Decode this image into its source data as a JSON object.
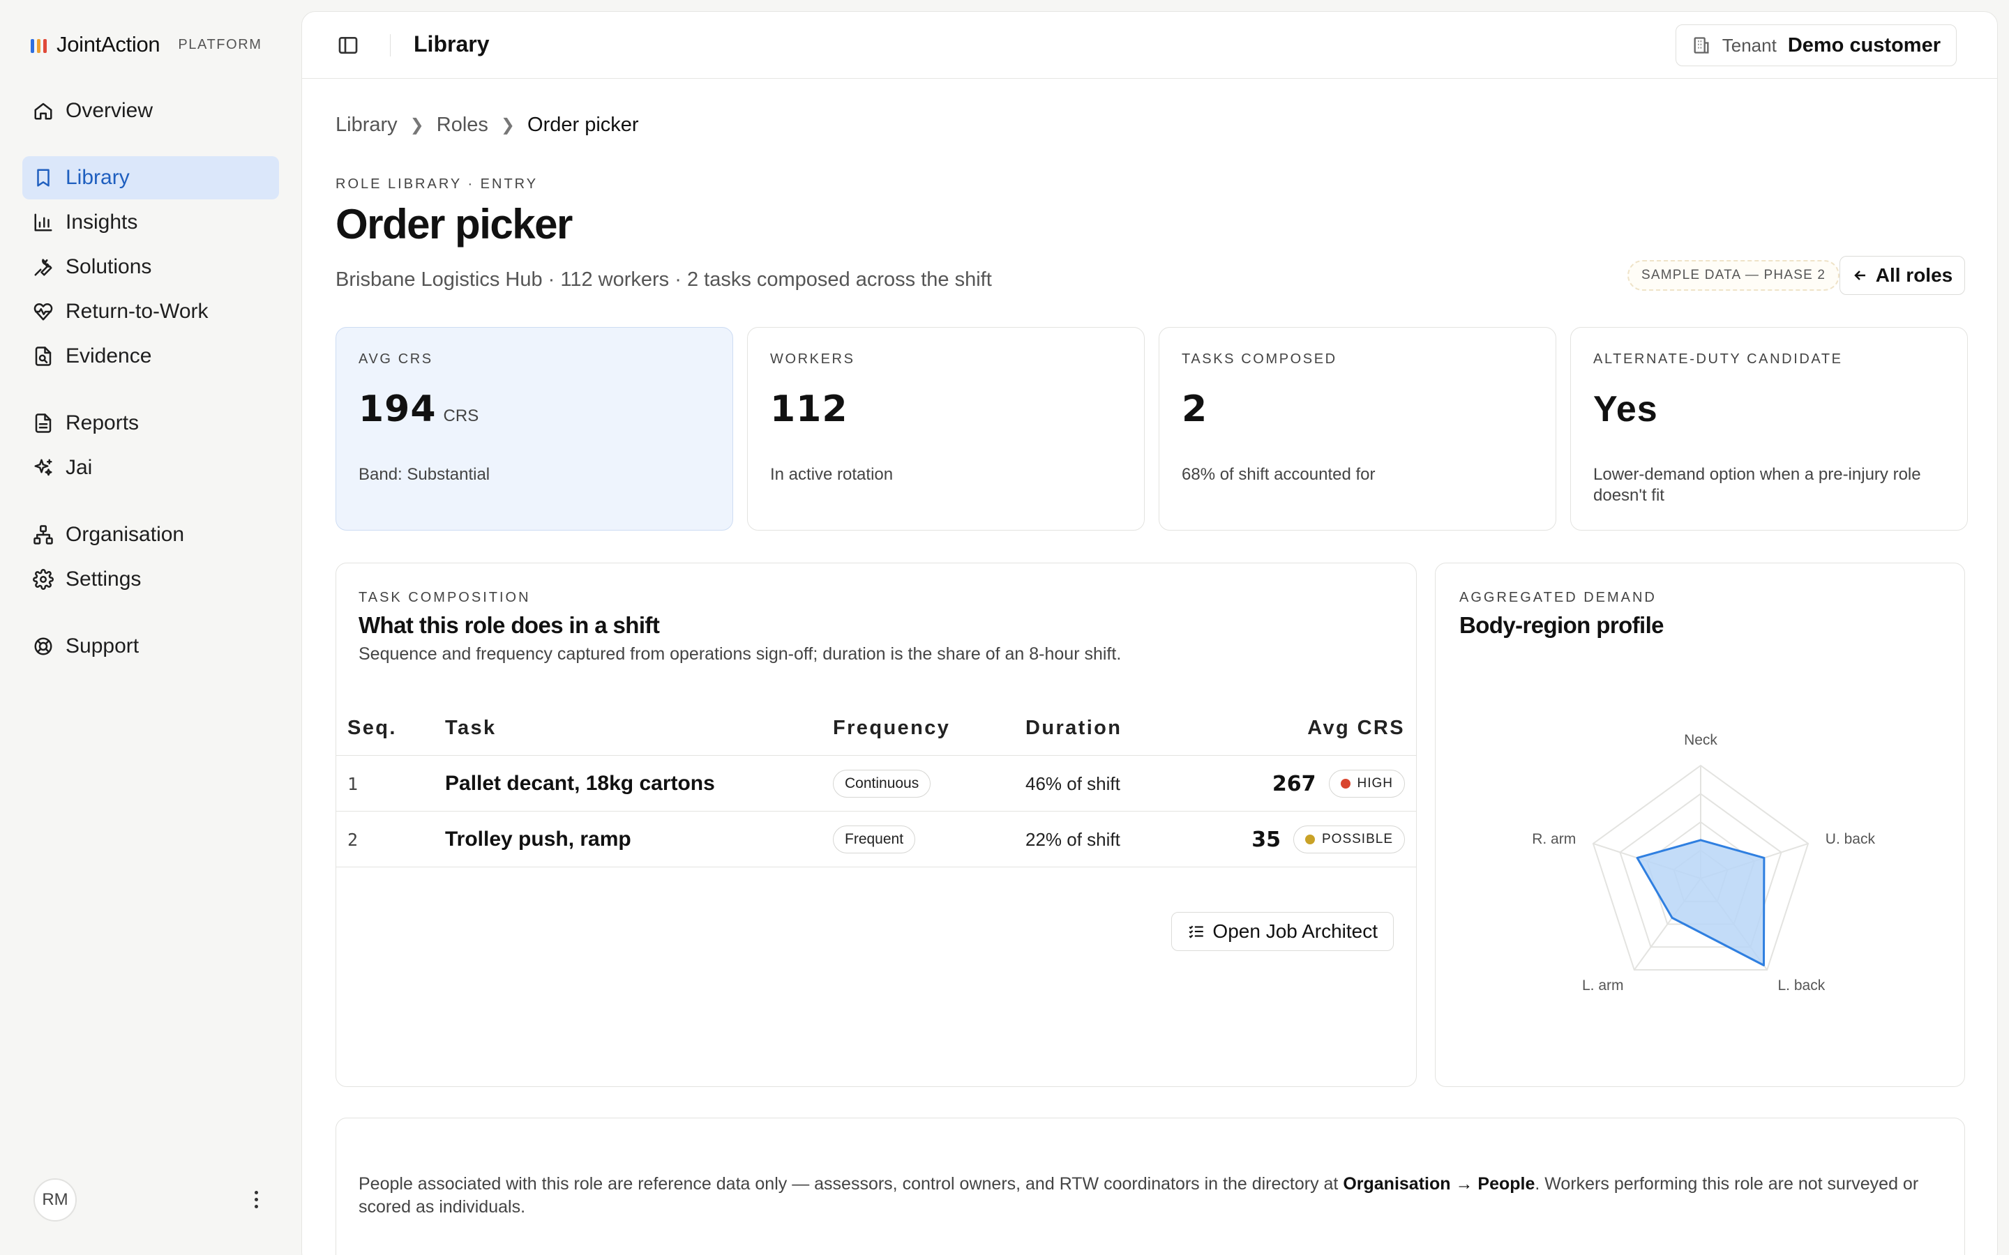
{
  "brand": {
    "name": "JointAction",
    "tag": "PLATFORM",
    "bar_colors": [
      "#2f6fe0",
      "#f0a030",
      "#e04a3a"
    ]
  },
  "sidebar": {
    "items": [
      {
        "label": "Overview",
        "icon": "home-icon"
      },
      {
        "label": "Library",
        "icon": "bookmark-icon",
        "active": true
      },
      {
        "label": "Insights",
        "icon": "bar-chart-icon"
      },
      {
        "label": "Solutions",
        "icon": "wrench-icon"
      },
      {
        "label": "Return-to-Work",
        "icon": "heart-pulse-icon"
      },
      {
        "label": "Evidence",
        "icon": "file-search-icon"
      },
      {
        "label": "Reports",
        "icon": "document-icon"
      },
      {
        "label": "Jai",
        "icon": "sparkles-icon"
      },
      {
        "label": "Organisation",
        "icon": "org-chart-icon"
      },
      {
        "label": "Settings",
        "icon": "gear-icon"
      },
      {
        "label": "Support",
        "icon": "lifebuoy-icon"
      }
    ],
    "user_initials": "RM"
  },
  "topbar": {
    "title": "Library",
    "tenant_label": "Tenant",
    "tenant_value": "Demo customer"
  },
  "breadcrumb": [
    "Library",
    "Roles",
    "Order picker"
  ],
  "page": {
    "eyebrow": "ROLE LIBRARY · ENTRY",
    "title": "Order picker",
    "subtitle": "Brisbane Logistics Hub · 112 workers · 2 tasks composed across the shift",
    "sample_badge": "SAMPLE DATA — PHASE 2",
    "back_label": "All roles"
  },
  "stats": [
    {
      "label": "AVG CRS",
      "value": "194",
      "unit": "CRS",
      "note": "Band: Substantial",
      "active": true
    },
    {
      "label": "WORKERS",
      "value": "112",
      "unit": "",
      "note": "In active rotation"
    },
    {
      "label": "TASKS COMPOSED",
      "value": "2",
      "unit": "",
      "note": "68% of shift accounted for"
    },
    {
      "label": "ALTERNATE-DUTY CANDIDATE",
      "value": "Yes",
      "unit": "",
      "note": "Lower-demand option when a pre-injury role doesn't fit"
    }
  ],
  "task_composition": {
    "eyebrow": "TASK COMPOSITION",
    "title": "What this role does in a shift",
    "description": "Sequence and frequency captured from operations sign-off; duration is the share of an 8-hour shift.",
    "columns": {
      "seq": "Seq.",
      "task": "Task",
      "frequency": "Frequency",
      "duration": "Duration",
      "avg_crs": "Avg CRS"
    },
    "rows": [
      {
        "seq": "1",
        "task": "Pallet decant, 18kg cartons",
        "frequency": "Continuous",
        "duration": "46% of shift",
        "crs": "267",
        "risk": "HIGH",
        "risk_color": "#d9452e"
      },
      {
        "seq": "2",
        "task": "Trolley push, ramp",
        "frequency": "Frequent",
        "duration": "22% of shift",
        "crs": "35",
        "risk": "POSSIBLE",
        "risk_color": "#c9a227"
      }
    ],
    "open_button": "Open Job Architect"
  },
  "aggregated_demand": {
    "eyebrow": "AGGREGATED DEMAND",
    "title": "Body-region profile",
    "axes": [
      "Neck",
      "U. back",
      "L. back",
      "L. arm",
      "R. arm"
    ],
    "values": [
      0.34,
      0.59,
      0.95,
      0.43,
      0.59
    ],
    "max": 1,
    "colors": {
      "fill": "#b9d6f7",
      "stroke": "#2f7fe0",
      "grid": "#e3e3e0"
    }
  },
  "footer_note": {
    "before": "People associated with this role are reference data only — assessors, control owners, and RTW coordinators in the directory at ",
    "link": "Organisation → People",
    "after": ". Workers performing this role are not surveyed or scored as individuals."
  }
}
